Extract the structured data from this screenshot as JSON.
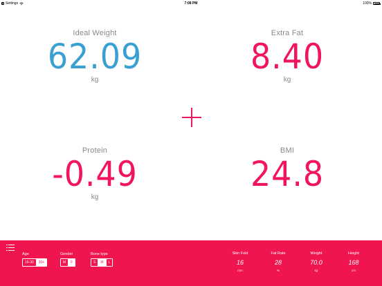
{
  "status_bar": {
    "back_app": "Settings",
    "time": "7:08 PM",
    "battery": "100%",
    "battery_level": 1.0
  },
  "metrics": {
    "ideal_weight": {
      "label": "Ideal Weight",
      "value": "62.09",
      "unit": "kg",
      "color": "#3aa0d2"
    },
    "extra_fat": {
      "label": "Extra Fat",
      "value": "8.40",
      "unit": "kg",
      "color": "#f0155e"
    },
    "protein": {
      "label": "Protein",
      "value": "-0.49",
      "unit": "kg",
      "color": "#f0155e"
    },
    "bmi": {
      "label": "BMI",
      "value": "24.8",
      "unit": "",
      "color": "#f0155e"
    }
  },
  "panel": {
    "color": "#f0154f",
    "age": {
      "label": "Age",
      "options": [
        "16-30",
        "30+"
      ],
      "selected": "30+"
    },
    "gender": {
      "label": "Gender",
      "options": [
        "M",
        "F"
      ],
      "selected": "F"
    },
    "bone_type": {
      "label": "Bone type",
      "options": [
        "S",
        "M",
        "L"
      ],
      "selected": "M"
    },
    "stats": [
      {
        "label": "Skin Fold",
        "value": "16",
        "unit": "mm"
      },
      {
        "label": "Fat Rate",
        "value": "28",
        "unit": "%"
      },
      {
        "label": "Weight",
        "value": "70.0",
        "unit": "kg"
      },
      {
        "label": "Height",
        "value": "168",
        "unit": "cm"
      }
    ]
  }
}
